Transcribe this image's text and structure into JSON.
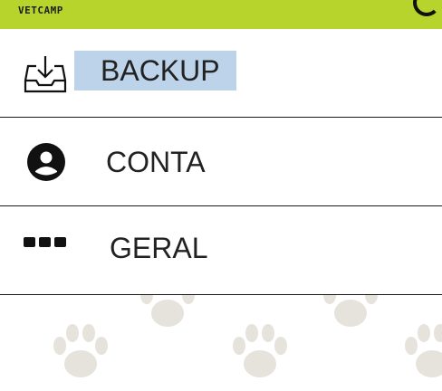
{
  "header": {
    "logo_text": "VETCAMP",
    "accent_color": "#b6d42b",
    "action_icon": "refresh-icon"
  },
  "menu": {
    "items": [
      {
        "label": "BACKUP",
        "icon": "download-tray-icon",
        "selected": true
      },
      {
        "label": "CONTA",
        "icon": "account-icon",
        "selected": false
      },
      {
        "label": "GERAL",
        "icon": "more-dots-icon",
        "selected": false
      }
    ]
  },
  "background": {
    "pattern": "paw-print-icon",
    "pattern_color": "#e6e3dc"
  }
}
